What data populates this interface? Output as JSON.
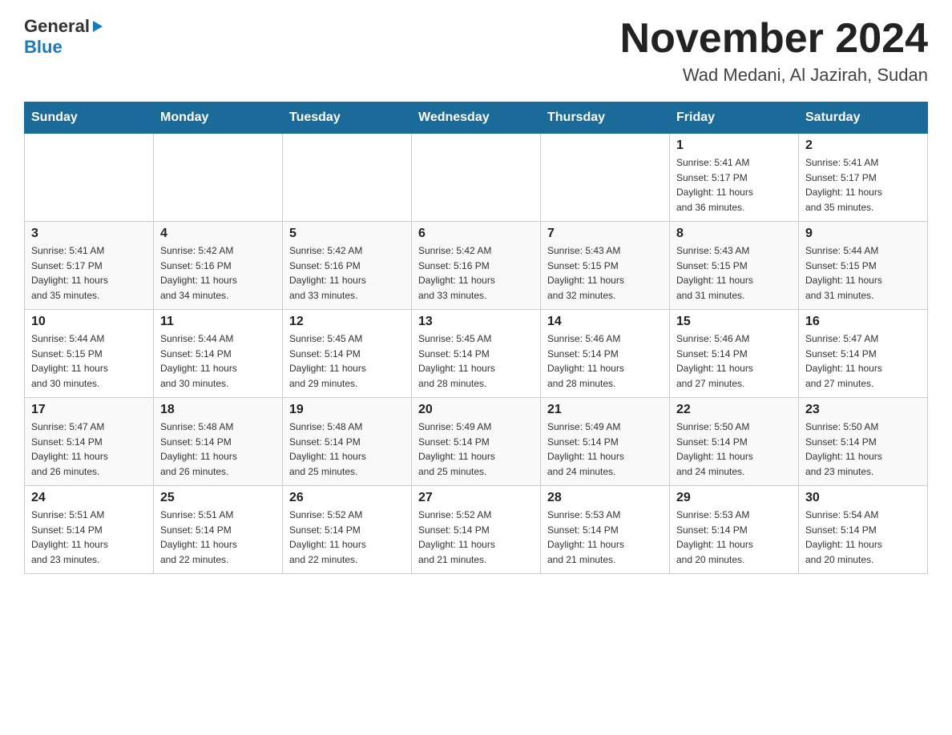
{
  "header": {
    "logo_general": "General",
    "logo_blue": "Blue",
    "month_title": "November 2024",
    "location": "Wad Medani, Al Jazirah, Sudan"
  },
  "weekdays": [
    "Sunday",
    "Monday",
    "Tuesday",
    "Wednesday",
    "Thursday",
    "Friday",
    "Saturday"
  ],
  "weeks": [
    [
      {
        "day": "",
        "info": ""
      },
      {
        "day": "",
        "info": ""
      },
      {
        "day": "",
        "info": ""
      },
      {
        "day": "",
        "info": ""
      },
      {
        "day": "",
        "info": ""
      },
      {
        "day": "1",
        "info": "Sunrise: 5:41 AM\nSunset: 5:17 PM\nDaylight: 11 hours\nand 36 minutes."
      },
      {
        "day": "2",
        "info": "Sunrise: 5:41 AM\nSunset: 5:17 PM\nDaylight: 11 hours\nand 35 minutes."
      }
    ],
    [
      {
        "day": "3",
        "info": "Sunrise: 5:41 AM\nSunset: 5:17 PM\nDaylight: 11 hours\nand 35 minutes."
      },
      {
        "day": "4",
        "info": "Sunrise: 5:42 AM\nSunset: 5:16 PM\nDaylight: 11 hours\nand 34 minutes."
      },
      {
        "day": "5",
        "info": "Sunrise: 5:42 AM\nSunset: 5:16 PM\nDaylight: 11 hours\nand 33 minutes."
      },
      {
        "day": "6",
        "info": "Sunrise: 5:42 AM\nSunset: 5:16 PM\nDaylight: 11 hours\nand 33 minutes."
      },
      {
        "day": "7",
        "info": "Sunrise: 5:43 AM\nSunset: 5:15 PM\nDaylight: 11 hours\nand 32 minutes."
      },
      {
        "day": "8",
        "info": "Sunrise: 5:43 AM\nSunset: 5:15 PM\nDaylight: 11 hours\nand 31 minutes."
      },
      {
        "day": "9",
        "info": "Sunrise: 5:44 AM\nSunset: 5:15 PM\nDaylight: 11 hours\nand 31 minutes."
      }
    ],
    [
      {
        "day": "10",
        "info": "Sunrise: 5:44 AM\nSunset: 5:15 PM\nDaylight: 11 hours\nand 30 minutes."
      },
      {
        "day": "11",
        "info": "Sunrise: 5:44 AM\nSunset: 5:14 PM\nDaylight: 11 hours\nand 30 minutes."
      },
      {
        "day": "12",
        "info": "Sunrise: 5:45 AM\nSunset: 5:14 PM\nDaylight: 11 hours\nand 29 minutes."
      },
      {
        "day": "13",
        "info": "Sunrise: 5:45 AM\nSunset: 5:14 PM\nDaylight: 11 hours\nand 28 minutes."
      },
      {
        "day": "14",
        "info": "Sunrise: 5:46 AM\nSunset: 5:14 PM\nDaylight: 11 hours\nand 28 minutes."
      },
      {
        "day": "15",
        "info": "Sunrise: 5:46 AM\nSunset: 5:14 PM\nDaylight: 11 hours\nand 27 minutes."
      },
      {
        "day": "16",
        "info": "Sunrise: 5:47 AM\nSunset: 5:14 PM\nDaylight: 11 hours\nand 27 minutes."
      }
    ],
    [
      {
        "day": "17",
        "info": "Sunrise: 5:47 AM\nSunset: 5:14 PM\nDaylight: 11 hours\nand 26 minutes."
      },
      {
        "day": "18",
        "info": "Sunrise: 5:48 AM\nSunset: 5:14 PM\nDaylight: 11 hours\nand 26 minutes."
      },
      {
        "day": "19",
        "info": "Sunrise: 5:48 AM\nSunset: 5:14 PM\nDaylight: 11 hours\nand 25 minutes."
      },
      {
        "day": "20",
        "info": "Sunrise: 5:49 AM\nSunset: 5:14 PM\nDaylight: 11 hours\nand 25 minutes."
      },
      {
        "day": "21",
        "info": "Sunrise: 5:49 AM\nSunset: 5:14 PM\nDaylight: 11 hours\nand 24 minutes."
      },
      {
        "day": "22",
        "info": "Sunrise: 5:50 AM\nSunset: 5:14 PM\nDaylight: 11 hours\nand 24 minutes."
      },
      {
        "day": "23",
        "info": "Sunrise: 5:50 AM\nSunset: 5:14 PM\nDaylight: 11 hours\nand 23 minutes."
      }
    ],
    [
      {
        "day": "24",
        "info": "Sunrise: 5:51 AM\nSunset: 5:14 PM\nDaylight: 11 hours\nand 23 minutes."
      },
      {
        "day": "25",
        "info": "Sunrise: 5:51 AM\nSunset: 5:14 PM\nDaylight: 11 hours\nand 22 minutes."
      },
      {
        "day": "26",
        "info": "Sunrise: 5:52 AM\nSunset: 5:14 PM\nDaylight: 11 hours\nand 22 minutes."
      },
      {
        "day": "27",
        "info": "Sunrise: 5:52 AM\nSunset: 5:14 PM\nDaylight: 11 hours\nand 21 minutes."
      },
      {
        "day": "28",
        "info": "Sunrise: 5:53 AM\nSunset: 5:14 PM\nDaylight: 11 hours\nand 21 minutes."
      },
      {
        "day": "29",
        "info": "Sunrise: 5:53 AM\nSunset: 5:14 PM\nDaylight: 11 hours\nand 20 minutes."
      },
      {
        "day": "30",
        "info": "Sunrise: 5:54 AM\nSunset: 5:14 PM\nDaylight: 11 hours\nand 20 minutes."
      }
    ]
  ]
}
